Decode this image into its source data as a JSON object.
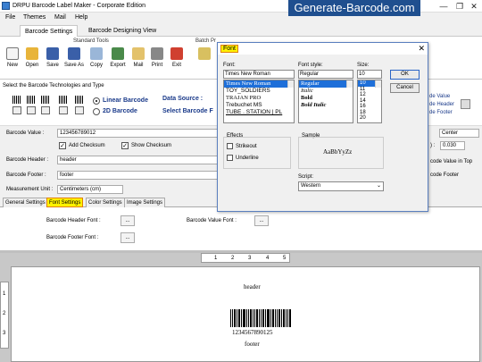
{
  "window": {
    "title": "DRPU Barcode Label Maker - Corporate Edition",
    "brand": "Generate-Barcode.com",
    "minimize": "—",
    "maximize": "❐",
    "close": "✕"
  },
  "menu": [
    "File",
    "Themes",
    "Mail",
    "Help"
  ],
  "ribbon_tabs": [
    "Barcode Settings",
    "Barcode Designing View"
  ],
  "ribbon": {
    "standard_tools_label": "Standard Tools",
    "batch_label": "Batch Pr",
    "tools": [
      "New",
      "Open",
      "Save",
      "Save As",
      "Copy",
      "Export",
      "Mail",
      "Print",
      "Exit"
    ]
  },
  "technologies": {
    "title": "Select the Barcode Technologies and Type",
    "linear": "Linear Barcode",
    "twod": "2D Barcode",
    "data_source": "Data Source :",
    "select_font": "Select Barcode F",
    "right_value": "de Value",
    "right_header": "de Header",
    "right_footer": "de Footer"
  },
  "form": {
    "barcode_value_label": "Barcode Value :",
    "barcode_value": "123456789012",
    "add_checksum": "Add Checksum",
    "show_checksum": "Show Checksum",
    "header_label": "Barcode Header :",
    "header_value": "header",
    "footer_label": "Barcode Footer :",
    "footer_value": "footer",
    "unit_label": "Measurement Unit :",
    "unit_value": "Centimeters (cm)",
    "align_value": "Center",
    "num_suffix": ") :",
    "num_value": "0.030",
    "value_in_top": "code Value in Top",
    "footer_right": "code Footer"
  },
  "lower_tabs": [
    "General Settings",
    "Font Settings",
    "Color Settings",
    "Image Settings"
  ],
  "font_panel": {
    "header_font_label": "Barcode Header Font :",
    "footer_font_label": "Barcode Footer Font :",
    "value_font_label": "Barcode Value Font :",
    "dots": "..."
  },
  "canvas": {
    "ruler_h": [
      "1",
      "2",
      "3",
      "4",
      "5"
    ],
    "ruler_v": [
      "1",
      "2",
      "3"
    ],
    "label_header": "header",
    "label_value": "1234567890125",
    "label_footer": "footer"
  },
  "dialog": {
    "title": "Font",
    "close": "✕",
    "font_label": "Font:",
    "font_value": "Times New Roman",
    "fonts": [
      "Times New Roman",
      "TOY_SOLDIERS",
      "TRAJAN PRO",
      "Trebuchet MS",
      "TUBE . STATION | PL"
    ],
    "style_label": "Font style:",
    "style_value": "Regular",
    "styles": [
      "Regular",
      "Italic",
      "Bold",
      "Bold Italic"
    ],
    "size_label": "Size:",
    "size_value": "10",
    "sizes": [
      "10",
      "11",
      "12",
      "14",
      "16",
      "18",
      "20"
    ],
    "ok": "OK",
    "cancel": "Cancel",
    "effects_label": "Effects",
    "strikeout": "Strikeout",
    "underline": "Underline",
    "sample_label": "Sample",
    "sample_text": "AaBbYyZz",
    "script_label": "Script:",
    "script_value": "Western"
  }
}
